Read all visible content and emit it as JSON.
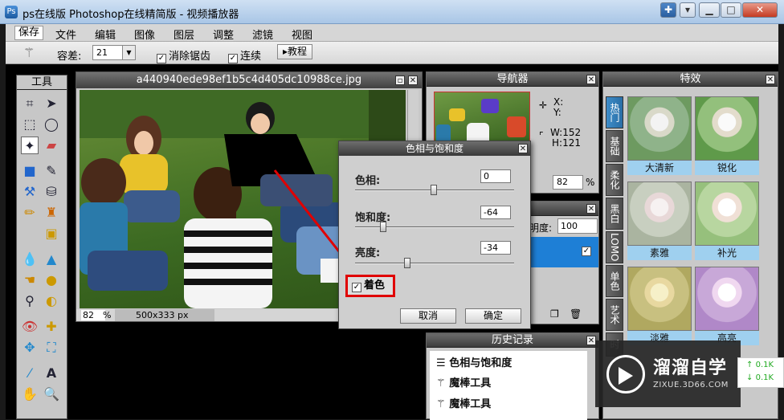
{
  "window": {
    "title": "ps在线版 Photoshop在线精简版 - 视频播放器"
  },
  "menu": [
    "保存",
    "文件",
    "编辑",
    "图像",
    "图层",
    "调整",
    "滤镜",
    "视图"
  ],
  "options": {
    "tolerance_label": "容差:",
    "tolerance_value": "21",
    "antialias_label": "消除锯齿",
    "contiguous_label": "连续",
    "tutorial_label": "教程"
  },
  "toolbox": {
    "title": "工具"
  },
  "image": {
    "filename": "a440940ede98ef1b5c4d405dc10988ce.jpg",
    "zoom": "82",
    "zoom_unit": "%",
    "size": "500x333 px"
  },
  "navigator": {
    "title": "导航器",
    "x_label": "X:",
    "y_label": "Y:",
    "w_label": "W:",
    "w_value": "152",
    "h_label": "H:",
    "h_value": "121",
    "zoom": "82",
    "zoom_unit": "%"
  },
  "layers": {
    "opacity_label": "明度:",
    "opacity_value": "100"
  },
  "history": {
    "title": "历史记录",
    "items": [
      "色相与饱和度",
      "魔棒工具",
      "魔棒工具"
    ]
  },
  "effects": {
    "title": "特效",
    "tabs": [
      "热门",
      "基础",
      "柔化",
      "黑白",
      "LOMO",
      "单色",
      "艺术",
      "时"
    ],
    "items": [
      "大清新",
      "锐化",
      "素雅",
      "补光",
      "淡雅",
      "高亮"
    ]
  },
  "dialog": {
    "title": "色相与饱和度",
    "hue_label": "色相:",
    "hue_value": "0",
    "saturation_label": "饱和度:",
    "saturation_value": "-64",
    "lightness_label": "亮度:",
    "lightness_value": "-34",
    "colorize_label": "着色",
    "cancel_label": "取消",
    "ok_label": "确定"
  },
  "watermark": {
    "title": "溜溜自学",
    "subtitle": "ZIXUE.3D66.COM"
  },
  "netmon": {
    "up": "0.1K",
    "down": "0.1K"
  }
}
